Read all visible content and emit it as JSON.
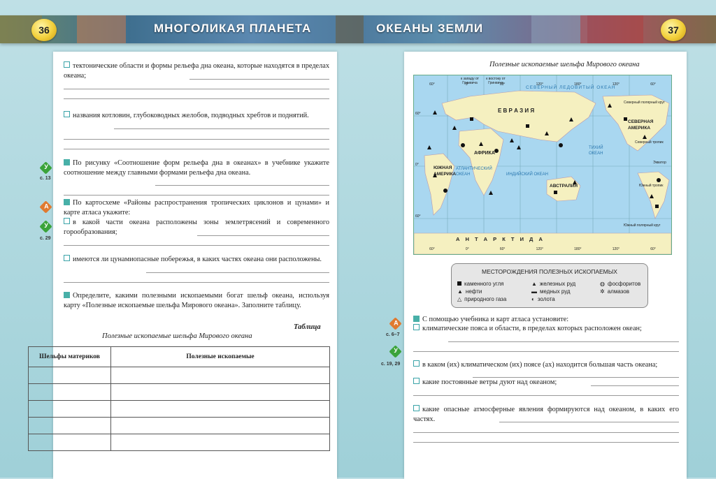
{
  "header": {
    "left_page_number": "36",
    "right_page_number": "37",
    "left_title": "МНОГОЛИКАЯ ПЛАНЕТА",
    "right_title": "ОКЕАНЫ ЗЕМЛИ"
  },
  "left_page": {
    "q1": "тектонические области и формы рельефа дна океана, которые находятся в пределах океана;",
    "q2": "названия котловин, глубоководных желобов, подводных хребтов и поднятий.",
    "q3": "По рисунку «Соотношение форм рельефа дна в океанах» в учебнике укажите соотношение между главными формами рельефа дна океана.",
    "q4": "По картосхеме «Районы распространения тропических циклонов и цунами» и карте атласа укажите:",
    "q5": "в какой части океана расположены зоны землетрясений и современного горообразования;",
    "q6": "имеются ли цунамиопасные побережья, в каких частях океана они расположены.",
    "q7": "Определите, какими полезными ископаемыми богат шельф океана, используя карту «Полезные ископаемые шельфа Мирового океана». Заполните таблицу.",
    "table_label": "Таблица",
    "table_caption": "Полезные ископаемые шельфа Мирового океана",
    "table_headers": [
      "Шельфы материков",
      "Полезные ископаемые"
    ],
    "refs": [
      "с. 13",
      "с. 29"
    ]
  },
  "right_page": {
    "map_title": "Полезные ископаемые шельфа Мирового океана",
    "map_labels": {
      "west": "к западу от Гринвича",
      "east": "к востоку от Гринвича",
      "arctic": "СЕВЕРНЫЙ ЛЕДОВИТЫЙ ОКЕАН",
      "eurasia": "Е В Р А З И Я",
      "africa": "АФРИКА",
      "n_america": "СЕВЕРНАЯ АМЕРИКА",
      "s_america": "ЮЖНАЯ АМЕРИКА",
      "australia": "АВСТРАЛИЯ",
      "antarctica": "А Н Т А Р К Т И Д А",
      "atlantic": "АТЛАНТИЧЕСКИЙ ОКЕАН",
      "indian": "ИНДИЙСКИЙ ОКЕАН",
      "pacific": "ТИХИЙ ОКЕАН",
      "arctic_circle": "Северный полярный круг",
      "n_tropic": "Северный тропик",
      "equator": "Экватор",
      "s_tropic": "Южный тропик",
      "antarctic_circle": "Южный полярный круг",
      "top_degrees": [
        "60°",
        "0°",
        "60°",
        "120°",
        "180°",
        "120°",
        "60°"
      ],
      "bottom_degrees": [
        "60°",
        "0°",
        "60°",
        "120°",
        "180°",
        "120°",
        "60°"
      ],
      "lat_deg": [
        "60°",
        "0°",
        "60°"
      ]
    },
    "legend_title": "МЕСТОРОЖДЕНИЯ ПОЛЕЗНЫХ ИСКОПАЕМЫХ",
    "legend": [
      "каменного угля",
      "нефти",
      "природного газа",
      "железных руд",
      "медных руд",
      "золота",
      "фосфоритов",
      "алмазов"
    ],
    "q1": "С помощью учебника и карт атласа установите:",
    "q2": "климатические пояса и области, в пределах которых расположен океан;",
    "q3": "в каком (их) климатическом (их) поясе (ах) находится большая часть океана;",
    "q4": "какие постоянные ветры дуют над океаном;",
    "q5": "какие опасные атмосферные явления формируются над океаном, в каких его частях.",
    "refs": [
      "с. 6–7",
      "с. 19, 29"
    ]
  }
}
